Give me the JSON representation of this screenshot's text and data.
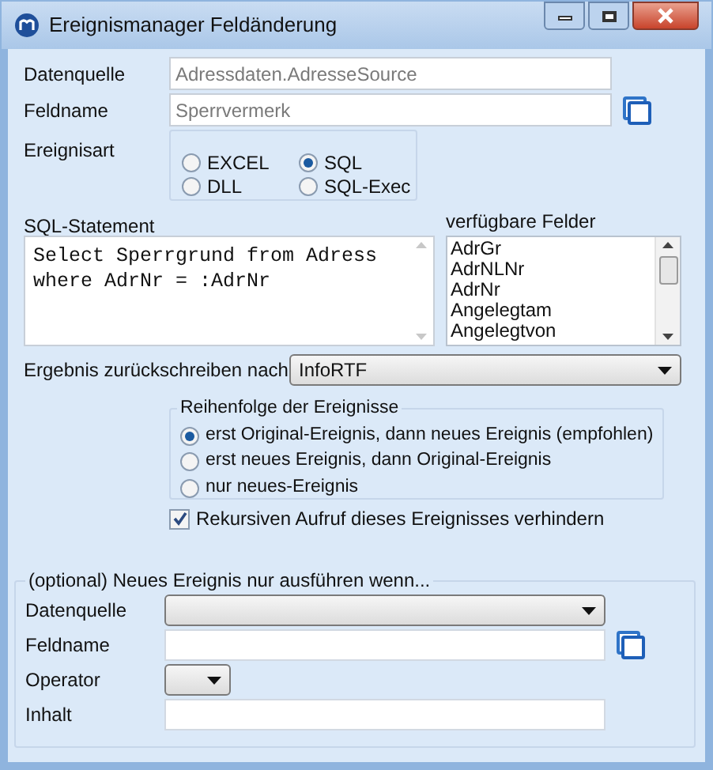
{
  "window": {
    "title": "Ereignismanager Feldänderung"
  },
  "source": {
    "label": "Datenquelle",
    "value": "Adressdaten.AdresseSource"
  },
  "field": {
    "label": "Feldname",
    "value": "Sperrvermerk"
  },
  "event_type": {
    "label": "Ereignisart",
    "options": [
      {
        "label": "EXCEL",
        "selected": false
      },
      {
        "label": "SQL",
        "selected": true
      },
      {
        "label": "DLL",
        "selected": false
      },
      {
        "label": "SQL-Exec",
        "selected": false
      }
    ]
  },
  "sql": {
    "label": "SQL-Statement",
    "value": "Select Sperrgrund from Adress\nwhere AdrNr = :AdrNr"
  },
  "available_fields": {
    "label": "verfügbare Felder",
    "items": [
      "AdrGr",
      "AdrNLNr",
      "AdrNr",
      "Angelegtam",
      "Angelegtvon"
    ]
  },
  "writeback": {
    "label": "Ergebnis zurückschreiben nach",
    "value": "InfoRTF"
  },
  "order": {
    "title": "Reihenfolge der Ereignisse",
    "options": [
      {
        "label": "erst Original-Ereignis, dann neues Ereignis (empfohlen)",
        "selected": true
      },
      {
        "label": "erst neues Ereignis, dann Original-Ereignis",
        "selected": false
      },
      {
        "label": "nur neues-Ereignis",
        "selected": false
      }
    ]
  },
  "prevent_recursion": {
    "label": "Rekursiven Aufruf dieses Ereignisses verhindern",
    "checked": true
  },
  "condition": {
    "title": "(optional) Neues Ereignis nur ausführen wenn...",
    "fields": [
      {
        "kind": "select",
        "label": "Datenquelle"
      },
      {
        "kind": "text",
        "label": "Feldname",
        "picker": true
      },
      {
        "kind": "select_small",
        "label": "Operator"
      },
      {
        "kind": "text",
        "label": "Inhalt",
        "picker": false
      }
    ]
  }
}
